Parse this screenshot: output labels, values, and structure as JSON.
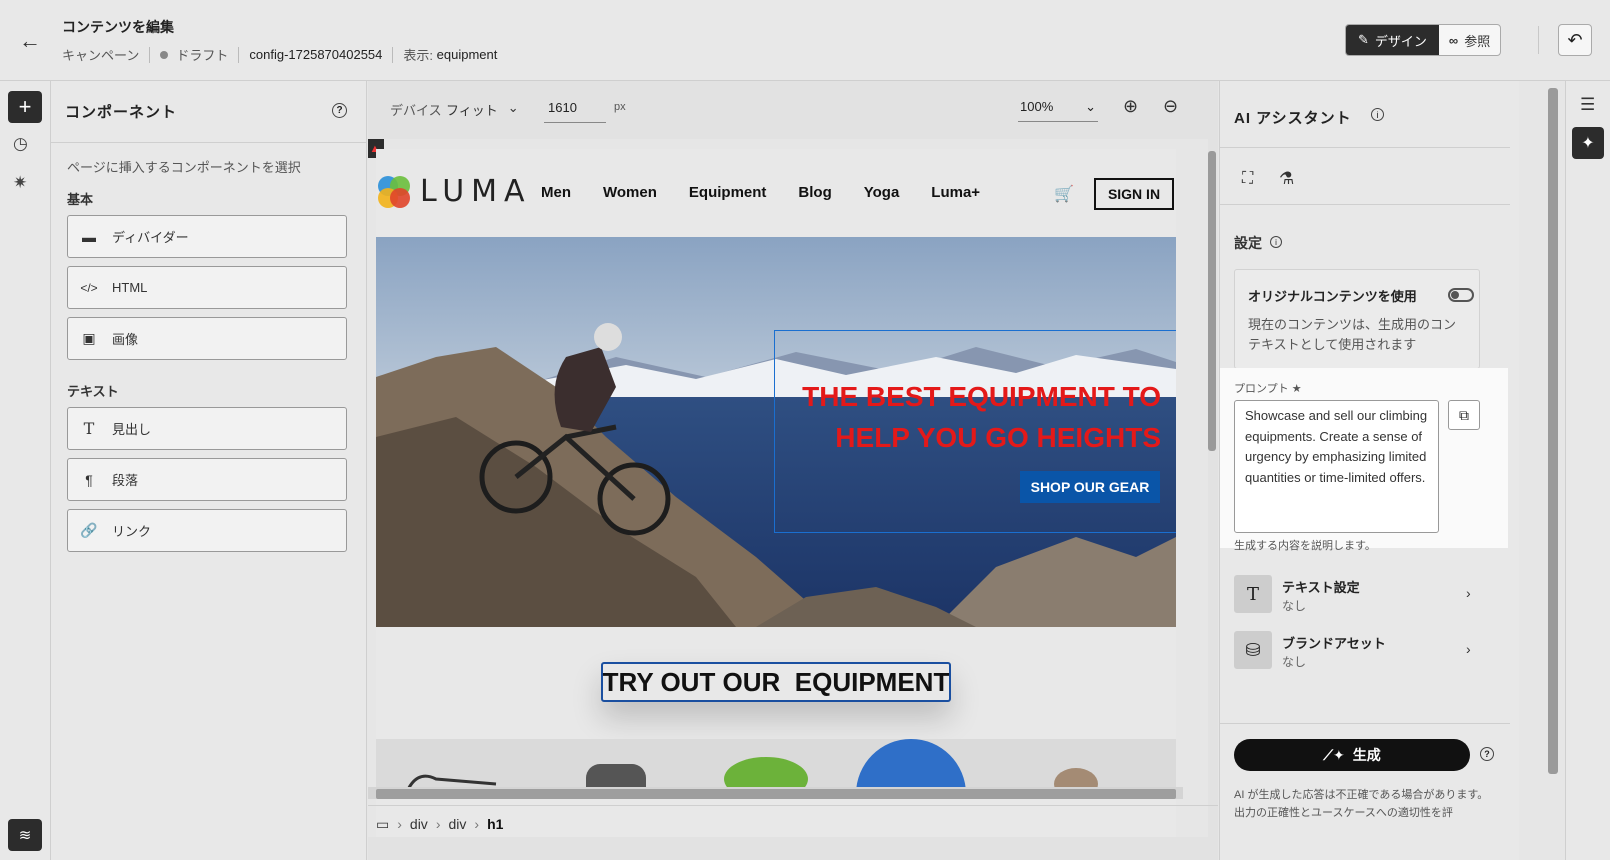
{
  "header": {
    "title": "コンテンツを編集",
    "campaign": "キャンペーン",
    "status": "ドラフト",
    "config": "config-1725870402554",
    "view_label": "表示:",
    "view_value": "equipment",
    "design_label": "デザイン",
    "view_mode_label": "参照"
  },
  "components": {
    "title": "コンポーネント",
    "hint": "ページに挿入するコンポーネントを選択",
    "basic_label": "基本",
    "basic_items": [
      "ディバイダー",
      "HTML",
      "画像"
    ],
    "text_label": "テキスト",
    "text_items": [
      "見出し",
      "段落",
      "リンク"
    ]
  },
  "toolbar": {
    "device_label": "デバイス",
    "fit_label": "フィット",
    "width_value": "1610",
    "px_label": "px",
    "zoom_value": "100%"
  },
  "preview": {
    "logo_text": "LUMA",
    "nav": [
      "Men",
      "Women",
      "Equipment",
      "Blog",
      "Yoga",
      "Luma+"
    ],
    "sign_in": "SIGN IN",
    "hero_line1": "THE BEST EQUIPMENT TO",
    "hero_line2": "HELP YOU GO HEIGHTS",
    "shop_button": "SHOP OUR GEAR",
    "section_heading": "TRY OUT OUR  EQUIPMENT"
  },
  "breadcrumb": [
    "div",
    "div",
    "h1"
  ],
  "ai": {
    "title": "AI アシスタント",
    "settings_label": "設定",
    "original_title": "オリジナルコンテンツを使用",
    "original_desc": "現在のコンテンツは、生成用のコンテキストとして使用されます",
    "prompt_label": "プロンプト ★",
    "prompt_text": "Showcase and sell our climbing equipments. Create a sense of urgency by emphasizing limited quantities or time-limited offers.",
    "prompt_hint": "生成する内容を説明します。",
    "text_settings_title": "テキスト設定",
    "text_settings_value": "なし",
    "brand_assets_title": "ブランドアセット",
    "brand_assets_value": "なし",
    "generate_label": "生成",
    "disclaimer": "AI が生成した応答は不正確である場合があります。出力の正確性とユースケースへの適切性を評"
  },
  "colors": {
    "accent_dark": "#2c2c2c",
    "hero_text": "#e41919",
    "shop_button": "#0a55a8",
    "selection": "#1a6fd0"
  },
  "icons": [
    "back-arrow-icon",
    "pencil-icon",
    "binoculars-icon",
    "undo-icon",
    "plus-icon",
    "history-icon",
    "spark-icon",
    "layers-icon",
    "help-icon",
    "divider-icon",
    "code-icon",
    "image-icon",
    "heading-icon",
    "paragraph-icon",
    "link-icon",
    "zoom-in-icon",
    "zoom-out-icon",
    "cart-icon",
    "folder-icon",
    "info-icon",
    "focus-icon",
    "flask-icon",
    "copy-icon",
    "text-icon",
    "brand-icon",
    "wand-icon",
    "sliders-icon"
  ]
}
